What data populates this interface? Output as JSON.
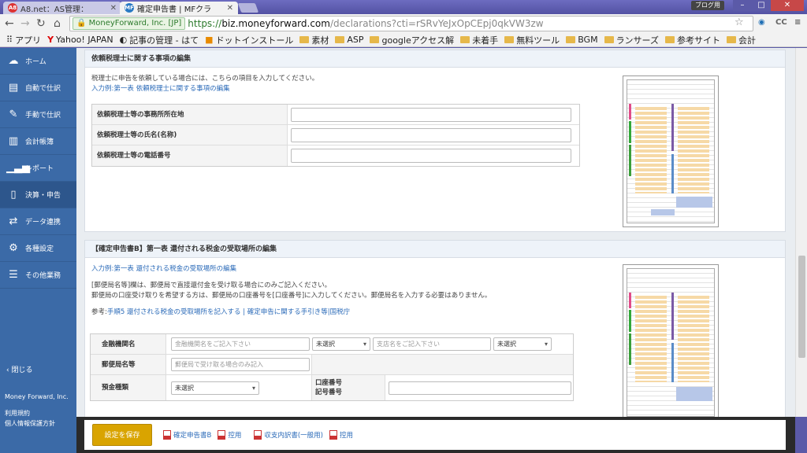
{
  "browser": {
    "tabs": [
      {
        "label": "A8.net：AS管理：",
        "favicon": "A8"
      },
      {
        "label": "確定申告書 | MFクラ",
        "favicon": "MF"
      }
    ],
    "profile_label": "ブログ用",
    "address": {
      "secure_label": "MoneyForward, Inc. [JP]",
      "protocol": "https://",
      "host": "biz.moneyforward.com",
      "rest": "/declarations?cti=rSRvYeJxOpCEpj0qkVW3zw"
    },
    "bookmarks": [
      {
        "label": "アプリ",
        "icon": "apps-icon"
      },
      {
        "label": "Yahoo! JAPAN",
        "icon": "yahoo-icon"
      },
      {
        "label": "記事の管理 - はて",
        "icon": "hatena-icon"
      },
      {
        "label": "ドットインストール",
        "icon": "dotinstall-icon"
      },
      {
        "label": "素材",
        "icon": "folder-icon"
      },
      {
        "label": "ASP",
        "icon": "folder-icon"
      },
      {
        "label": "googleアクセス解",
        "icon": "folder-icon"
      },
      {
        "label": "未着手",
        "icon": "folder-icon"
      },
      {
        "label": "無料ツール",
        "icon": "folder-icon"
      },
      {
        "label": "BGM",
        "icon": "folder-icon"
      },
      {
        "label": "ランサーズ",
        "icon": "folder-icon"
      },
      {
        "label": "参考サイト",
        "icon": "folder-icon"
      },
      {
        "label": "会計",
        "icon": "folder-icon"
      }
    ]
  },
  "sidebar": {
    "items": [
      {
        "label": "ホーム",
        "icon": "cloud-icon"
      },
      {
        "label": "自動で仕訳",
        "icon": "auto-journal-icon"
      },
      {
        "label": "手動で仕訳",
        "icon": "manual-journal-icon"
      },
      {
        "label": "会計帳簿",
        "icon": "book-icon"
      },
      {
        "label": "レポート",
        "icon": "chart-icon"
      },
      {
        "label": "決算・申告",
        "icon": "declaration-icon"
      },
      {
        "label": "データ連携",
        "icon": "data-link-icon"
      },
      {
        "label": "各種設定",
        "icon": "gear-icon"
      },
      {
        "label": "その他業務",
        "icon": "list-icon"
      }
    ],
    "close_label": "閉じる",
    "company": "Money Forward, Inc.",
    "terms": "利用規約",
    "privacy": "個人情報保護方針"
  },
  "section1": {
    "title": "依頼税理士に関する事項の編集",
    "desc": "税理士に申告を依頼している場合には、こちらの項目を入力してください。",
    "example_link": "入力例:第一表 依頼税理士に関する事項の編集",
    "fields": [
      {
        "label": "依頼税理士等の事務所所在地",
        "value": ""
      },
      {
        "label": "依頼税理士等の氏名(名称)",
        "value": ""
      },
      {
        "label": "依頼税理士等の電話番号",
        "value": ""
      }
    ]
  },
  "section2": {
    "title": "【確定申告書B】第一表 還付される税金の受取場所の編集",
    "example_link": "入力例:第一表 還付される税金の受取場所の編集",
    "note1": "[郵便局名等]欄は、郵便局で直接還付金を受け取る場合にのみご記入ください。",
    "note2": "郵便局の口座受け取りを希望する方は、郵便局の口座番号を[口座番号]に入力してください。郵便局名を入力する必要はありません。",
    "ref_prefix": "参考:",
    "ref_link1": "手順5 還付される税金の受取場所を記入する",
    "ref_sep": "|",
    "ref_link2": "確定申告に関する手引き等",
    "ref_sep2": "|",
    "ref_link3": "国税庁",
    "bank_label": "金融機関名",
    "bank_placeholder": "金融機関名をご記入下さい",
    "bank_type": "未選択",
    "branch_placeholder": "支店名をご記入下さい",
    "branch_type": "未選択",
    "post_label": "郵便局名等",
    "post_placeholder": "郵便局で受け取る場合のみ記入",
    "deposit_label": "預金種類",
    "deposit_value": "未選択",
    "account_label_1": "口座番号",
    "account_label_2": "記号番号",
    "account_value": ""
  },
  "footer": {
    "save_label": "設定を保存",
    "links": [
      "確定申告書B",
      "控用",
      "収支内訳書(一般用)",
      "控用"
    ]
  }
}
